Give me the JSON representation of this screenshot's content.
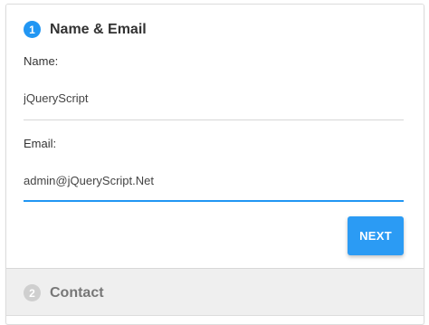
{
  "colors": {
    "accent": "#2196f3",
    "button_bg": "#2b9bf4",
    "inactive_num_bg": "#cfcfcf",
    "title_active": "#333333",
    "title_inactive": "#777777",
    "underline_idle": "#d6d6d6"
  },
  "steps": [
    {
      "number": "1",
      "title": "Name & Email",
      "state": "active",
      "fields": [
        {
          "label": "Name:",
          "value": "jQueryScript",
          "focused": false
        },
        {
          "label": "Email:",
          "value": "admin@jQueryScript.Net",
          "focused": true
        }
      ],
      "next_label": "NEXT"
    },
    {
      "number": "2",
      "title": "Contact",
      "state": "inactive"
    }
  ]
}
